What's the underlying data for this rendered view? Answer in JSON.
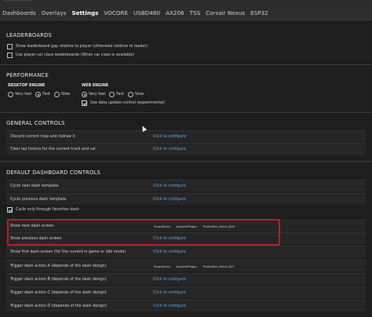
{
  "tabs": [
    {
      "label": "Dashboards"
    },
    {
      "label": "Overlays"
    },
    {
      "label": "Settings"
    },
    {
      "label": "VOCORE"
    },
    {
      "label": "USBD480"
    },
    {
      "label": "AX206"
    },
    {
      "label": "TSS"
    },
    {
      "label": "Corsair Nexus"
    },
    {
      "label": "ESP32"
    }
  ],
  "leaderboards": {
    "title": "LEADERBOARDS",
    "options": [
      {
        "label": "Show leaderboard gap relative to player (otherwise relative to leader)",
        "checked": false
      },
      {
        "label": "Use player car class leaderboards (When car class is available)",
        "checked": false
      }
    ]
  },
  "performance": {
    "title": "PERFORMANCE",
    "desktop": {
      "title": "DESKTOP ENGINE",
      "options": [
        "Very fast",
        "Fast",
        "Slow"
      ],
      "selected": "Fast"
    },
    "web": {
      "title": "WEB ENGINE",
      "options": [
        "Very fast",
        "Fast",
        "Slow"
      ],
      "selected": "Very fast",
      "data_update_label": "Use data update control (experimental)",
      "data_update_checked": true
    }
  },
  "general": {
    "title": "GENERAL CONTROLS",
    "rows": [
      {
        "label": "Discard current map and redraw it",
        "link": "Click to configure"
      },
      {
        "label": "Clear lap history for the current track and car",
        "link": "Click to configure"
      }
    ]
  },
  "dashboard": {
    "title": "DEFAULT DASHBOARD CONTROLS",
    "rows": [
      {
        "label": "Cycle next dash template",
        "link": "Click to configure"
      },
      {
        "label": "Cycle previous dash template",
        "link": "Click to configure"
      },
      {
        "label": "Show next dash screen",
        "keys": [
          "ShortAndLi",
          "JoystickPlugin",
          "ProSwitch_Panel_B16"
        ]
      },
      {
        "label": "Show previous dash screen",
        "link": "Click to configure"
      },
      {
        "label": "Show first dash screen (for the current in game or idle mode)",
        "link": "Click to configure"
      },
      {
        "label": "Trigger dash action A (depends of the dash design)",
        "keys": [
          "ShortAndLi",
          "JoystickPlugin",
          "ProSwitch_Panel_B17"
        ]
      },
      {
        "label": "Trigger dash action B (depends of the dash design)",
        "link": "Click to configure"
      },
      {
        "label": "Trigger dash action C (depends of the dash design)",
        "link": "Click to configure"
      },
      {
        "label": "Trigger dash action D (depends of the dash design)",
        "link": "Click to configure"
      }
    ],
    "cycle_favorites_label": "Cycle only through favorites dash",
    "cycle_favorites_checked": true
  }
}
